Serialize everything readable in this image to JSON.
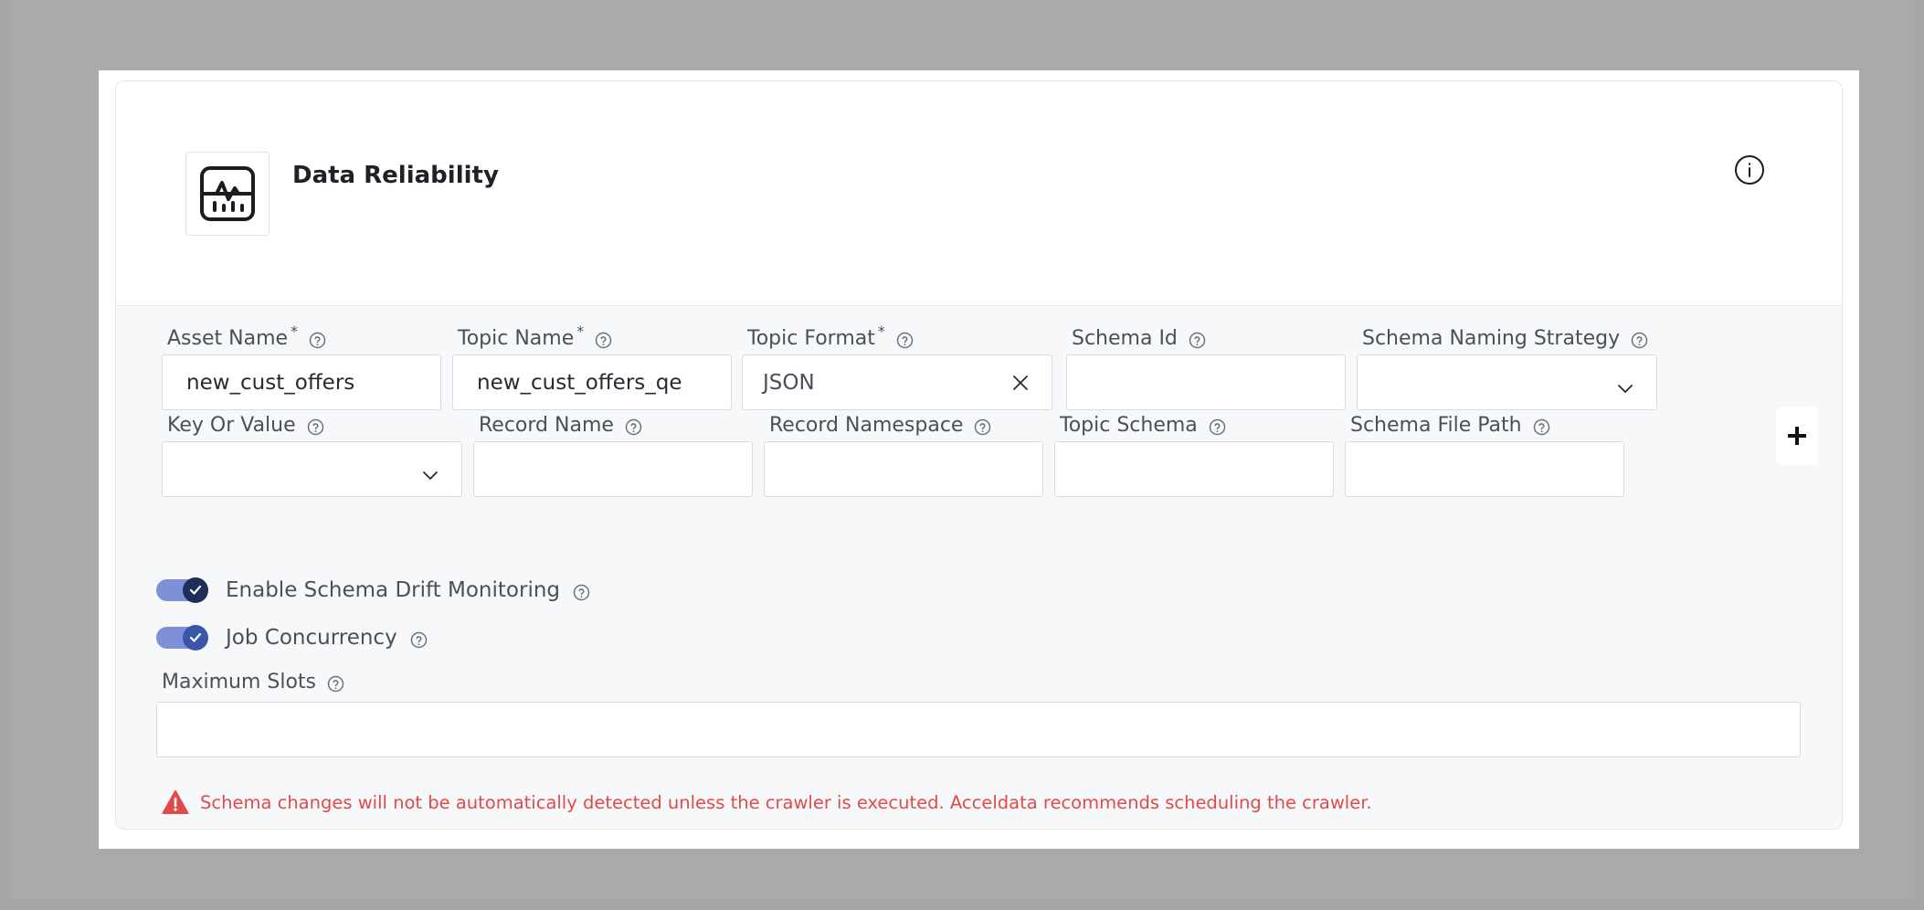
{
  "card": {
    "title": "Data Reliability",
    "icon": "monitor-chart-icon",
    "info_icon": "info-circle-icon"
  },
  "fields_row1": [
    {
      "label": "Asset Name",
      "required": "*",
      "value": "new_cust_offers",
      "type": "text"
    },
    {
      "label": "Topic Name",
      "required": "*",
      "value": "new_cust_offers_qe",
      "type": "text"
    },
    {
      "label": "Topic Format",
      "required": "*",
      "value": "JSON",
      "type": "select-clearable"
    },
    {
      "label": "Schema Id",
      "required": "",
      "value": "",
      "type": "text"
    },
    {
      "label": "Schema Naming Strategy",
      "required": "",
      "value": "",
      "type": "select"
    }
  ],
  "fields_row2": [
    {
      "label": "Key Or Value",
      "value": "",
      "type": "select"
    },
    {
      "label": "Record Name",
      "value": "",
      "type": "text"
    },
    {
      "label": "Record Namespace",
      "value": "",
      "type": "text"
    },
    {
      "label": "Topic Schema",
      "value": "",
      "type": "text"
    },
    {
      "label": "Schema File Path",
      "value": "",
      "type": "text"
    }
  ],
  "toggles": [
    {
      "label": "Enable Schema Drift Monitoring",
      "checked": true,
      "knob_color": "#1f2d5c"
    },
    {
      "label": "Job Concurrency",
      "checked": true,
      "knob_color": "#3a56a8"
    }
  ],
  "max_slots": {
    "label": "Maximum Slots",
    "value": ""
  },
  "warning": {
    "text": "Schema changes will not be automatically detected unless the crawler is executed. Acceldata recommends scheduling the crawler.",
    "icon": "warning-triangle-icon",
    "color": "#e14a4a"
  },
  "add_button_icon": "plus-icon"
}
